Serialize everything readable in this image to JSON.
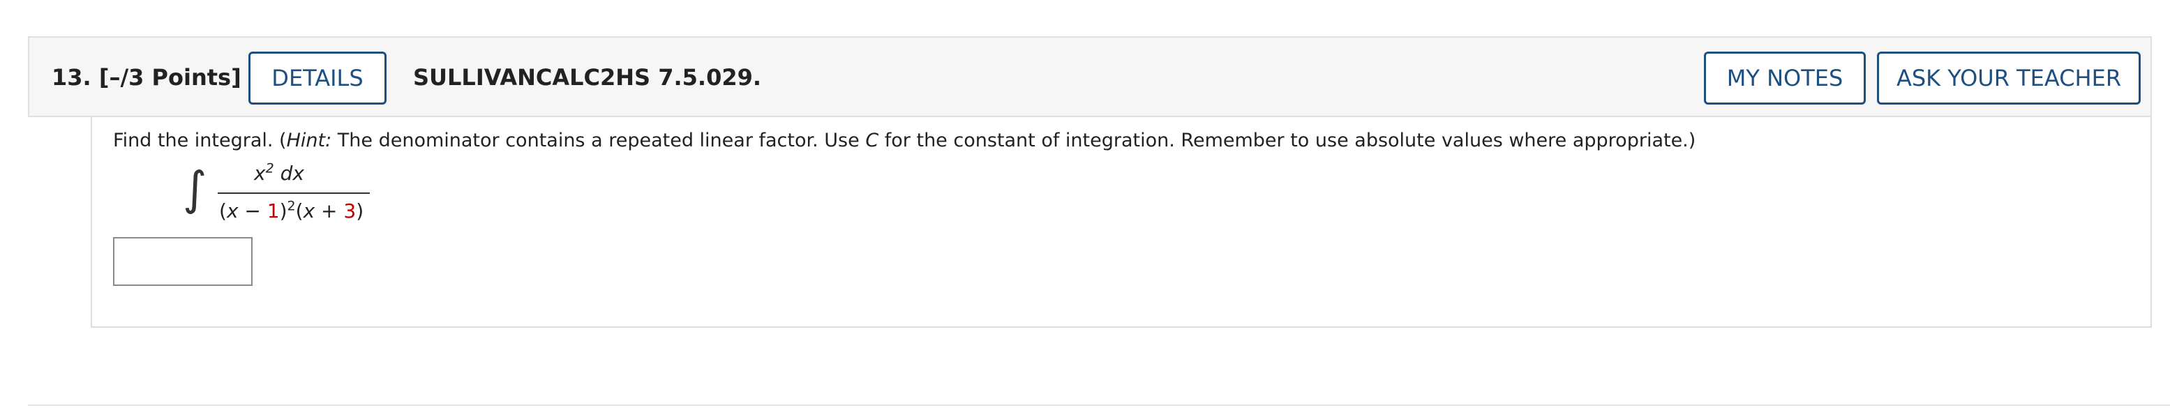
{
  "question": {
    "number": "13.",
    "points": "[–/3 Points]",
    "code": "SULLIVANCALC2HS 7.5.029."
  },
  "buttons": {
    "details": "DETAILS",
    "my_notes": "MY NOTES",
    "ask_teacher": "ASK YOUR TEACHER"
  },
  "prompt": {
    "lead": "Find the integral. (",
    "hint_label": "Hint:",
    "hint_text_1": " The denominator contains a repeated linear factor. Use ",
    "constant": "C",
    "hint_text_2": " for the constant of integration. Remember to use absolute values where appropriate.)"
  },
  "integral": {
    "sign": "∫",
    "numerator_var": "x",
    "numerator_exp": "2",
    "numerator_diff": " dx",
    "denom_open": "(",
    "denom_var1": "x",
    "denom_minus": " − ",
    "denom_const1": "1",
    "denom_close1": ")",
    "denom_exp": "2",
    "denom_open2": "(",
    "denom_var2": "x",
    "denom_plus": " + ",
    "denom_const2": "3",
    "denom_close2": ")"
  },
  "answer": {
    "value": ""
  },
  "colors": {
    "accent": "#1d4f80",
    "header_bg": "#f6f6f6",
    "highlight_red": "#c00000"
  }
}
